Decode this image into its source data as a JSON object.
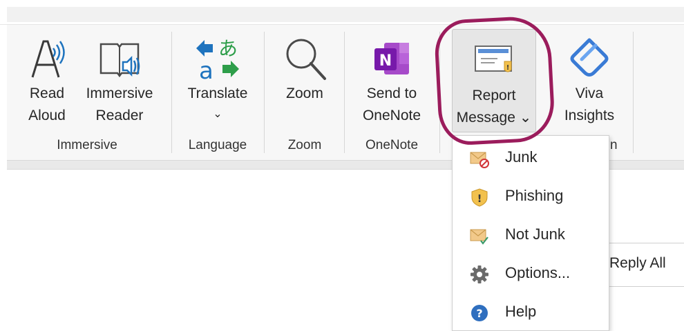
{
  "ribbon": {
    "buttons": [
      {
        "id": "read-aloud",
        "line1": "Read",
        "line2": "Aloud"
      },
      {
        "id": "immersive-reader",
        "line1": "Immersive",
        "line2": "Reader"
      },
      {
        "id": "translate",
        "line1": "Translate",
        "line2": "⌄"
      },
      {
        "id": "zoom",
        "line1": "Zoom",
        "line2": ""
      },
      {
        "id": "send-to-onenote",
        "line1": "Send to",
        "line2": "OneNote"
      },
      {
        "id": "report-message",
        "line1": "Report",
        "line2": "Message ⌄"
      },
      {
        "id": "viva-insights",
        "line1": "Viva",
        "line2": "Insights"
      }
    ],
    "groups": {
      "immersive": "Immersive",
      "language": "Language",
      "zoom": "Zoom",
      "onenote": "OneNote",
      "partial": "n"
    }
  },
  "dropdown": {
    "items": [
      {
        "label": "Junk",
        "icon": "junk-envelope-icon"
      },
      {
        "label": "Phishing",
        "icon": "phishing-shield-icon"
      },
      {
        "label": "Not Junk",
        "icon": "not-junk-envelope-icon"
      },
      {
        "label": "Options...",
        "icon": "gear-icon"
      },
      {
        "label": "Help",
        "icon": "help-icon"
      }
    ]
  },
  "reading_pane": {
    "reply_all_label": "Reply All"
  },
  "colors": {
    "highlight_circle": "#9b1c5c",
    "onenote_purple": "#7719aa",
    "translate_blue": "#1e73be",
    "translate_green": "#2e9e4a",
    "viva_blue": "#3a7bd5",
    "help_blue": "#2f6fbf",
    "warning_yellow": "#f2c14e"
  }
}
